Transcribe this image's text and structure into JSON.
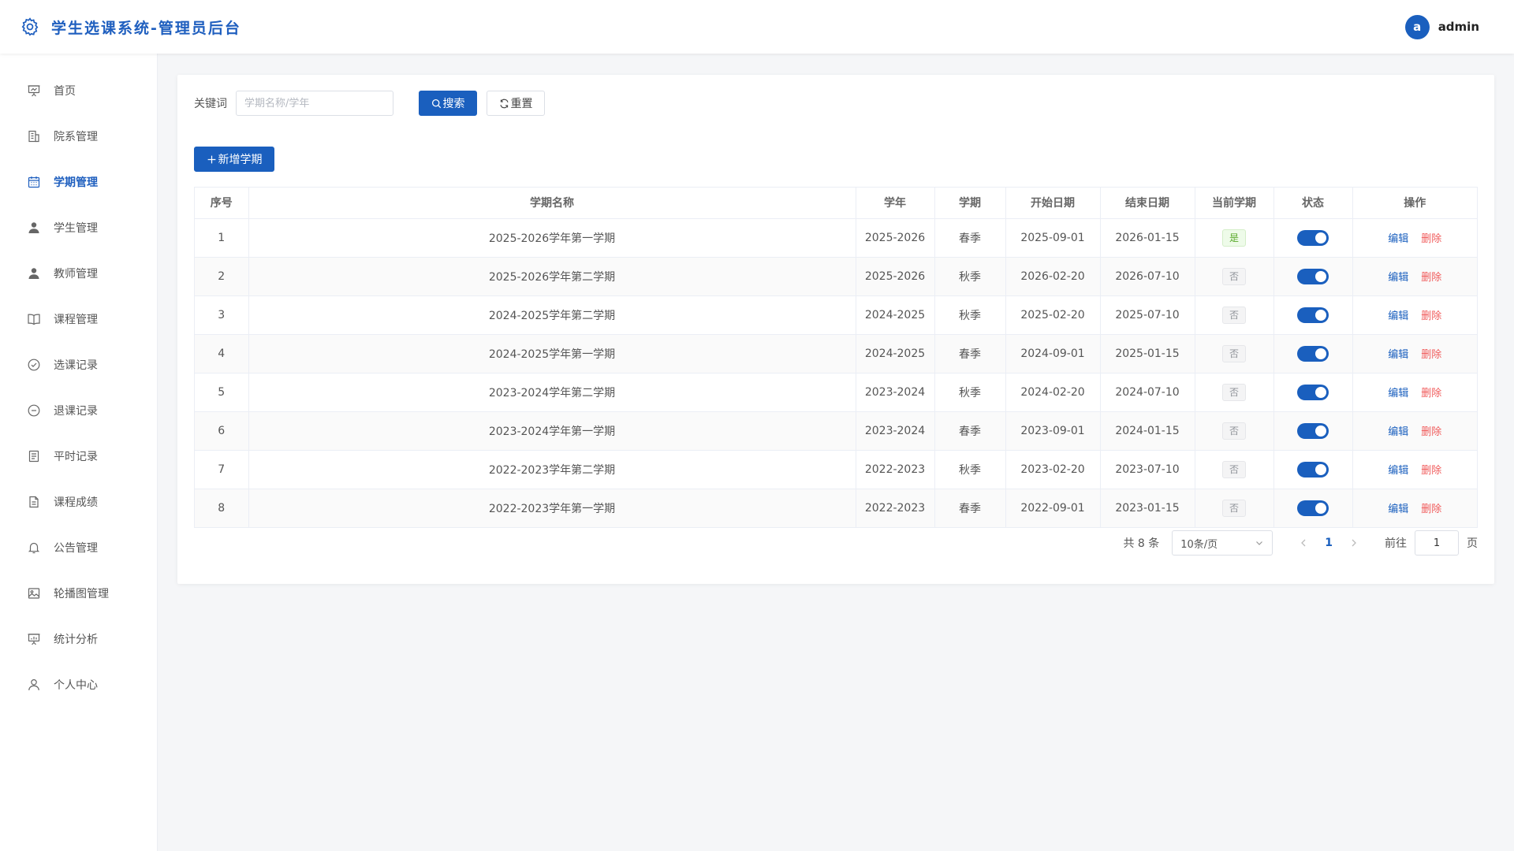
{
  "header": {
    "title": "学生选课系统-管理员后台",
    "icon": "gear-icon",
    "avatar_letter": "a",
    "username": "admin"
  },
  "sidebar": {
    "items": [
      {
        "label": "首页",
        "icon": "presentation-icon"
      },
      {
        "label": "院系管理",
        "icon": "building-icon"
      },
      {
        "label": "学期管理",
        "icon": "calendar-icon",
        "active": true
      },
      {
        "label": "学生管理",
        "icon": "user-filled-icon"
      },
      {
        "label": "教师管理",
        "icon": "user-filled-icon"
      },
      {
        "label": "课程管理",
        "icon": "book-icon"
      },
      {
        "label": "选课记录",
        "icon": "check-circle-icon"
      },
      {
        "label": "退课记录",
        "icon": "minus-circle-icon"
      },
      {
        "label": "平时记录",
        "icon": "notes-icon"
      },
      {
        "label": "课程成绩",
        "icon": "document-icon"
      },
      {
        "label": "公告管理",
        "icon": "bell-icon"
      },
      {
        "label": "轮播图管理",
        "icon": "picture-icon"
      },
      {
        "label": "统计分析",
        "icon": "chart-board-icon"
      },
      {
        "label": "个人中心",
        "icon": "user-outline-icon"
      }
    ]
  },
  "filter": {
    "keyword_label": "关键词",
    "keyword_placeholder": "学期名称/学年",
    "keyword_value": "",
    "search_label": "搜索",
    "reset_label": "重置"
  },
  "add_button_label": "新增学期",
  "table": {
    "columns": [
      "序号",
      "学期名称",
      "学年",
      "学期",
      "开始日期",
      "结束日期",
      "当前学期",
      "状态",
      "操作"
    ],
    "edit_label": "编辑",
    "delete_label": "删除",
    "rows": [
      {
        "index": "1",
        "name": "2025-2026学年第一学期",
        "year": "2025-2026",
        "term": "春季",
        "start": "2025-09-01",
        "end": "2026-01-15",
        "current": "是",
        "status_on": true
      },
      {
        "index": "2",
        "name": "2025-2026学年第二学期",
        "year": "2025-2026",
        "term": "秋季",
        "start": "2026-02-20",
        "end": "2026-07-10",
        "current": "否",
        "status_on": true
      },
      {
        "index": "3",
        "name": "2024-2025学年第二学期",
        "year": "2024-2025",
        "term": "秋季",
        "start": "2025-02-20",
        "end": "2025-07-10",
        "current": "否",
        "status_on": true
      },
      {
        "index": "4",
        "name": "2024-2025学年第一学期",
        "year": "2024-2025",
        "term": "春季",
        "start": "2024-09-01",
        "end": "2025-01-15",
        "current": "否",
        "status_on": true
      },
      {
        "index": "5",
        "name": "2023-2024学年第二学期",
        "year": "2023-2024",
        "term": "秋季",
        "start": "2024-02-20",
        "end": "2024-07-10",
        "current": "否",
        "status_on": true
      },
      {
        "index": "6",
        "name": "2023-2024学年第一学期",
        "year": "2023-2024",
        "term": "春季",
        "start": "2023-09-01",
        "end": "2024-01-15",
        "current": "否",
        "status_on": true
      },
      {
        "index": "7",
        "name": "2022-2023学年第二学期",
        "year": "2022-2023",
        "term": "秋季",
        "start": "2023-02-20",
        "end": "2023-07-10",
        "current": "否",
        "status_on": true
      },
      {
        "index": "8",
        "name": "2022-2023学年第一学期",
        "year": "2022-2023",
        "term": "春季",
        "start": "2022-09-01",
        "end": "2023-01-15",
        "current": "否",
        "status_on": true
      }
    ]
  },
  "pagination": {
    "total_text": "共 8 条",
    "page_size": "10条/页",
    "current_page": "1",
    "goto_label": "前往",
    "goto_value": "1",
    "page_unit": "页"
  },
  "colors": {
    "primary": "#1a5fbe",
    "danger": "#f05a5a",
    "success": "#5aa92b"
  }
}
